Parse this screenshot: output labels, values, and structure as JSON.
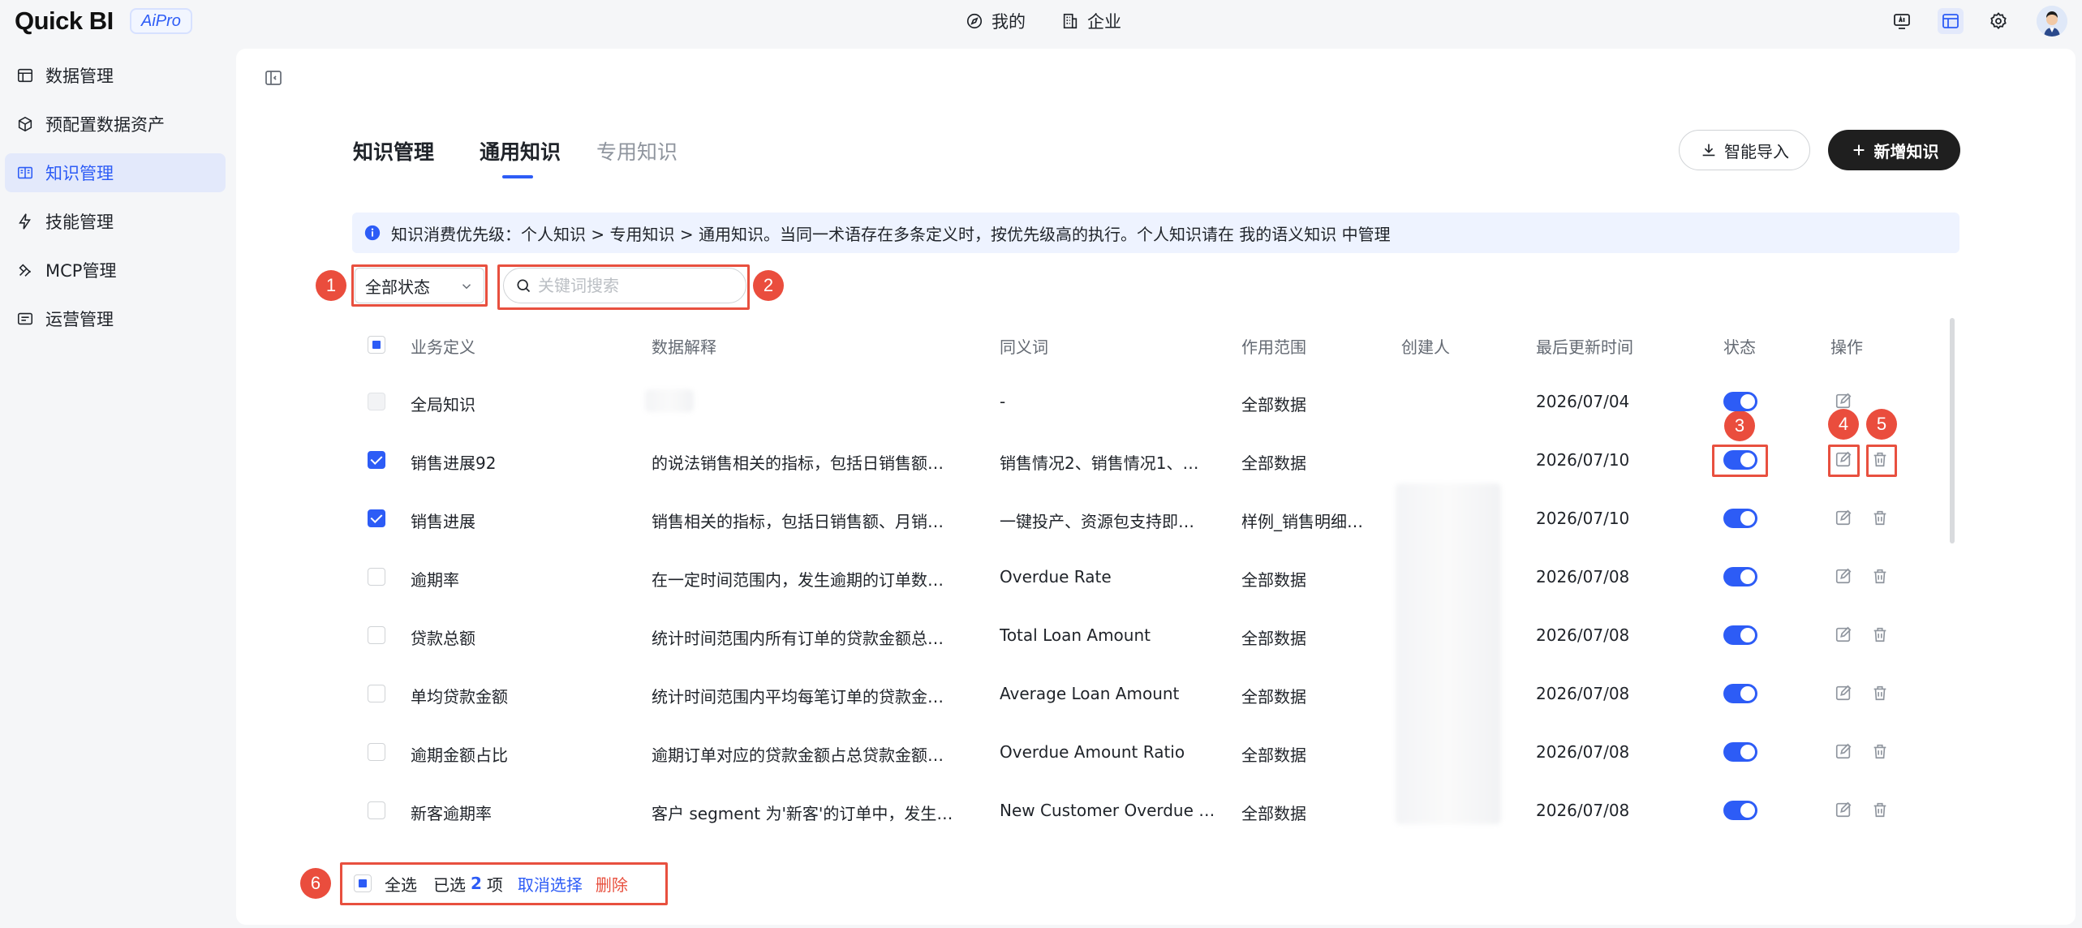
{
  "app": {
    "logo": "Quick BI",
    "badge": "AiPro"
  },
  "topnav": {
    "mine": "我的",
    "enterprise": "企业"
  },
  "sidebar": {
    "items": [
      {
        "label": "数据管理",
        "icon": "data-management-icon"
      },
      {
        "label": "预配置数据资产",
        "icon": "cube-icon"
      },
      {
        "label": "知识管理",
        "icon": "book-icon",
        "active": true
      },
      {
        "label": "技能管理",
        "icon": "lightning-icon"
      },
      {
        "label": "MCP管理",
        "icon": "mcp-icon"
      },
      {
        "label": "运营管理",
        "icon": "operations-icon"
      }
    ]
  },
  "header": {
    "page_title": "知识管理",
    "tabs": [
      {
        "label": "通用知识",
        "active": true
      },
      {
        "label": "专用知识",
        "active": false
      }
    ],
    "import_label": "智能导入",
    "add_label": "新增知识"
  },
  "info": {
    "text": "知识消费优先级：个人知识 > 专用知识 > 通用知识。当同一术语存在多条定义时，按优先级高的执行。个人知识请在 我的语义知识 中管理"
  },
  "filters": {
    "status_value": "全部状态",
    "search_placeholder": "关键词搜索"
  },
  "table": {
    "columns": [
      "业务定义",
      "数据解释",
      "同义词",
      "作用范围",
      "创建人",
      "最后更新时间",
      "状态",
      "操作"
    ],
    "rows": [
      {
        "definition": "全局知识",
        "explanation": "",
        "synonyms": "-",
        "scope": "全部数据",
        "creator": "",
        "updated": "2026/07/04",
        "enabled": true,
        "checked": false,
        "disabled": true
      },
      {
        "definition": "销售进展92",
        "explanation": "的说法销售相关的指标，包括日销售额…",
        "synonyms": "销售情况2、销售情况1、…",
        "scope": "全部数据",
        "creator": "",
        "updated": "2026/07/10",
        "enabled": true,
        "checked": true,
        "disabled": false
      },
      {
        "definition": "销售进展",
        "explanation": "销售相关的指标，包括日销售额、月销…",
        "synonyms": "一键投产、资源包支持即…",
        "scope": "样例_销售明细…",
        "creator": "",
        "updated": "2026/07/10",
        "enabled": true,
        "checked": true,
        "disabled": false
      },
      {
        "definition": "逾期率",
        "explanation": "在一定时间范围内，发生逾期的订单数…",
        "synonyms": "Overdue Rate",
        "scope": "全部数据",
        "creator": "",
        "updated": "2026/07/08",
        "enabled": true,
        "checked": false,
        "disabled": false
      },
      {
        "definition": "贷款总额",
        "explanation": "统计时间范围内所有订单的贷款金额总…",
        "synonyms": "Total Loan Amount",
        "scope": "全部数据",
        "creator": "",
        "updated": "2026/07/08",
        "enabled": true,
        "checked": false,
        "disabled": false
      },
      {
        "definition": "单均贷款金额",
        "explanation": "统计时间范围内平均每笔订单的贷款金…",
        "synonyms": "Average Loan Amount",
        "scope": "全部数据",
        "creator": "",
        "updated": "2026/07/08",
        "enabled": true,
        "checked": false,
        "disabled": false
      },
      {
        "definition": "逾期金额占比",
        "explanation": "逾期订单对应的贷款金额占总贷款金额…",
        "synonyms": "Overdue Amount Ratio",
        "scope": "全部数据",
        "creator": "",
        "updated": "2026/07/08",
        "enabled": true,
        "checked": false,
        "disabled": false
      },
      {
        "definition": "新客逾期率",
        "explanation": "客户 segment 为'新客'的订单中，发生…",
        "synonyms": "New Customer Overdue …",
        "scope": "全部数据",
        "creator": "",
        "updated": "2026/07/08",
        "enabled": true,
        "checked": false,
        "disabled": false
      }
    ]
  },
  "footer": {
    "select_all": "全选",
    "selected_prefix": "已选",
    "selected_count": "2",
    "selected_suffix": "项",
    "cancel_label": "取消选择",
    "delete_label": "删除"
  },
  "annotations": {
    "badges": [
      "1",
      "2",
      "3",
      "4",
      "5",
      "6"
    ]
  },
  "colors": {
    "accent": "#2d5cf6",
    "annotation_red": "#e8503f",
    "primary_button": "#1f1f1f",
    "info_bg": "#eef3ff",
    "danger": "#e8503f"
  }
}
